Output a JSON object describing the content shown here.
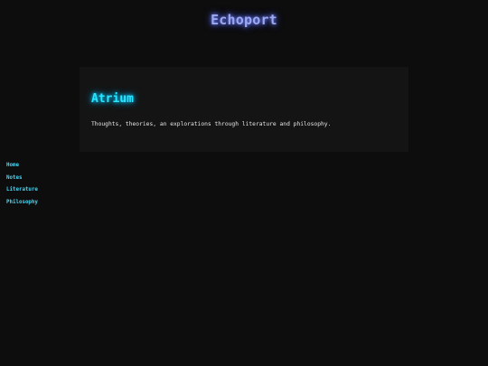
{
  "site": {
    "title": "Echoport"
  },
  "hero": {
    "title": "Atrium",
    "description": "Thoughts, theories, an explorations through literature and philosophy."
  },
  "nav": {
    "items": [
      {
        "label": "Home"
      },
      {
        "label": "Notes"
      },
      {
        "label": "Literature"
      },
      {
        "label": "Philosophy"
      }
    ]
  },
  "colors": {
    "background": "#0d0d0d",
    "panel": "#141414",
    "site_title": "#9ca8f0",
    "accent_cyan": "#28e6ff",
    "nav_link": "#45d8f6",
    "body_text": "#e6e6e6"
  }
}
